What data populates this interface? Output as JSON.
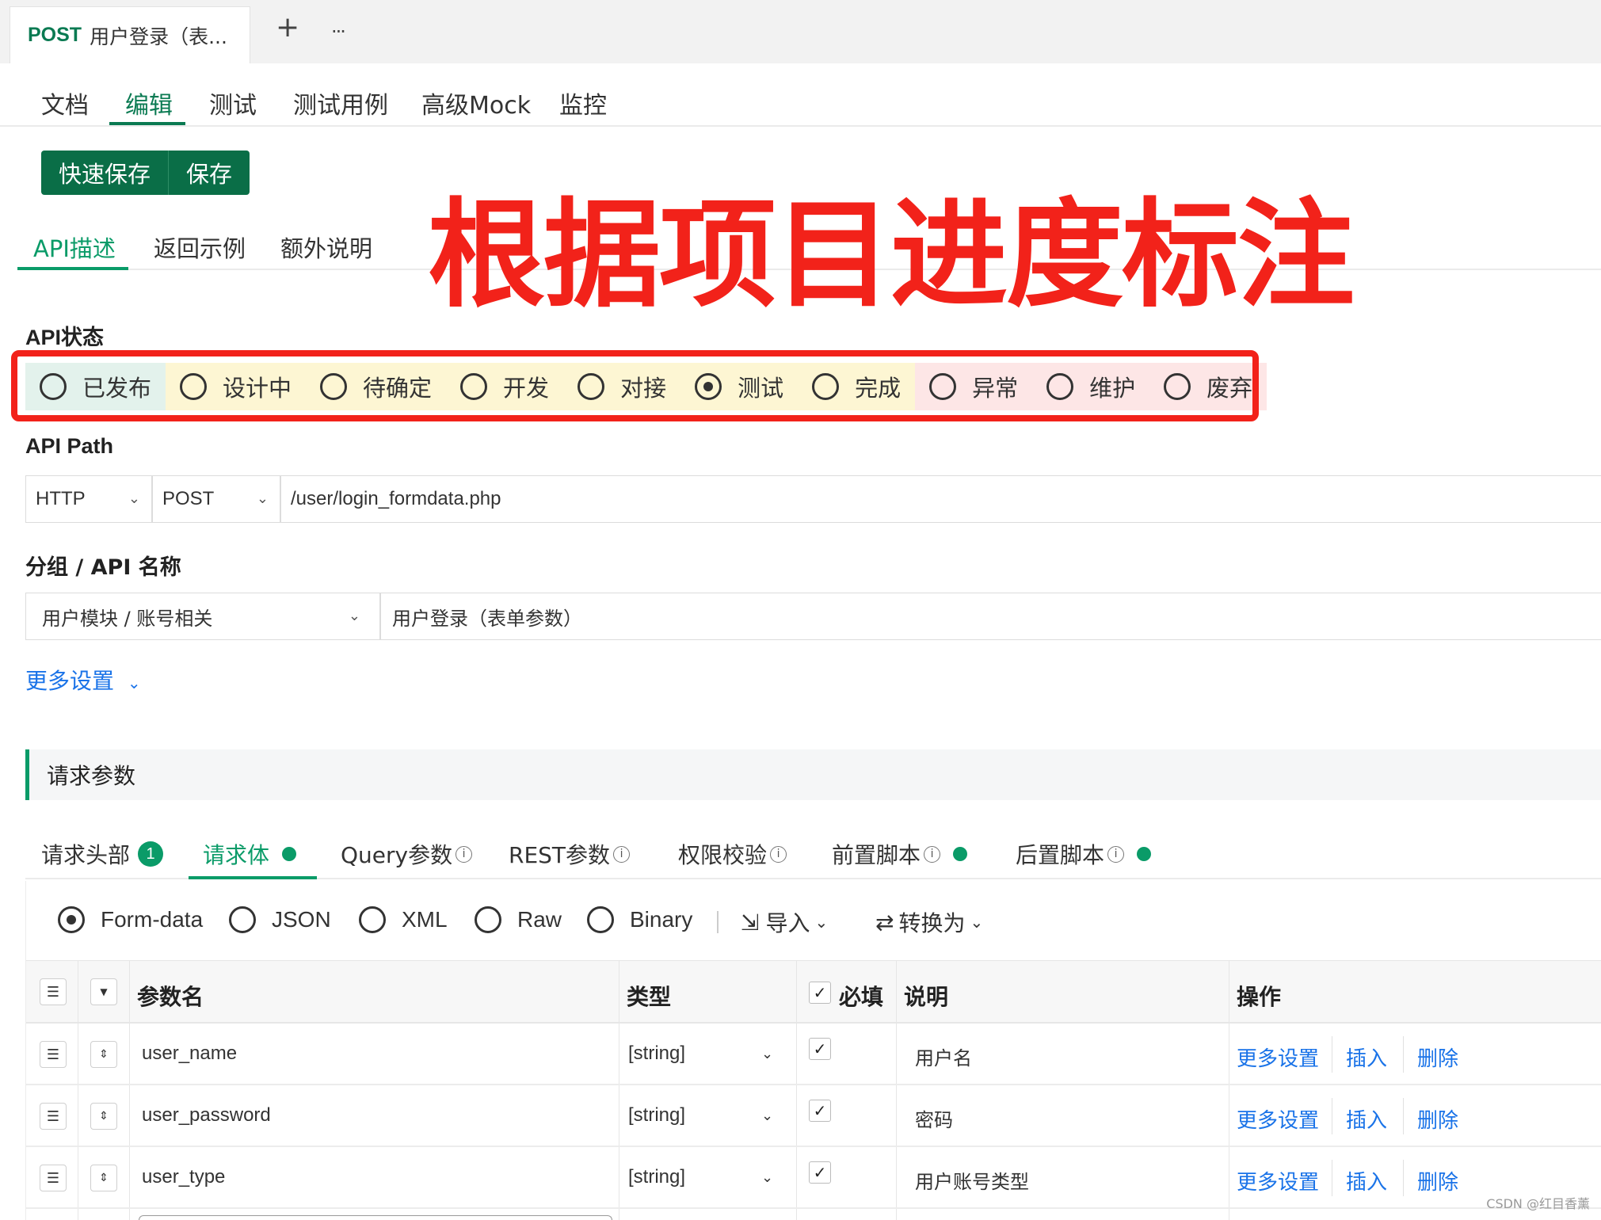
{
  "doc_tab": {
    "method": "POST",
    "name": "用户登录（表..."
  },
  "strip": {
    "add": "+",
    "more": "···"
  },
  "main_nav": [
    "文档",
    "编辑",
    "测试",
    "测试用例",
    "高级Mock",
    "监控"
  ],
  "save": {
    "quick": "快速保存",
    "save": "保存"
  },
  "sub_nav": [
    "API描述",
    "返回示例",
    "额外说明"
  ],
  "annotation": "根据项目进度标注",
  "api_status": {
    "label": "API状态",
    "options": [
      {
        "label": "已发布",
        "bg": "#e3f2ec",
        "checked": false
      },
      {
        "label": "设计中",
        "bg": "#fdf6d3",
        "checked": false
      },
      {
        "label": "待确定",
        "bg": "#fdf6d3",
        "checked": false
      },
      {
        "label": "开发",
        "bg": "#fdf6d3",
        "checked": false
      },
      {
        "label": "对接",
        "bg": "#fdf6d3",
        "checked": false
      },
      {
        "label": "测试",
        "bg": "#fdf6d3",
        "checked": true
      },
      {
        "label": "完成",
        "bg": "#fdf6d3",
        "checked": false
      },
      {
        "label": "异常",
        "bg": "#fde6e6",
        "checked": false
      },
      {
        "label": "维护",
        "bg": "#fde6e6",
        "checked": false
      },
      {
        "label": "废弃",
        "bg": "#fde6e6",
        "checked": false
      }
    ]
  },
  "api_path": {
    "label": "API Path",
    "protocol": "HTTP",
    "method": "POST",
    "path": "/user/login_formdata.php"
  },
  "group": {
    "label": "分组 / API 名称",
    "group": "用户模块 / 账号相关",
    "name": "用户登录（表单参数）"
  },
  "more_settings": "更多设置",
  "section_title": "请求参数",
  "param_tabs": {
    "header": "请求头部",
    "header_count": "1",
    "body": "请求体",
    "query": "Query参数",
    "rest": "REST参数",
    "auth": "权限校验",
    "pre": "前置脚本",
    "post": "后置脚本",
    "info": "i"
  },
  "body_types": {
    "formdata": "Form-data",
    "json": "JSON",
    "xml": "XML",
    "raw": "Raw",
    "binary": "Binary",
    "import": "导入",
    "convert": "转换为"
  },
  "table": {
    "headers": {
      "name": "参数名",
      "type": "类型",
      "required": "必填",
      "desc": "说明",
      "ops": "操作"
    },
    "rows": [
      {
        "name": "user_name",
        "type": "[string]",
        "desc": "用户名"
      },
      {
        "name": "user_password",
        "type": "[string]",
        "desc": "密码"
      },
      {
        "name": "user_type",
        "type": "[string]",
        "desc": "用户账号类型"
      }
    ],
    "ops": {
      "more": "更多设置",
      "insert": "插入",
      "delete": "删除"
    }
  },
  "watermark": "CSDN @红目香薰",
  "colors": {
    "accent": "#0a9b68",
    "save_btn": "#0a6e47",
    "annotation": "#f2221a",
    "link": "#1a73e8"
  }
}
